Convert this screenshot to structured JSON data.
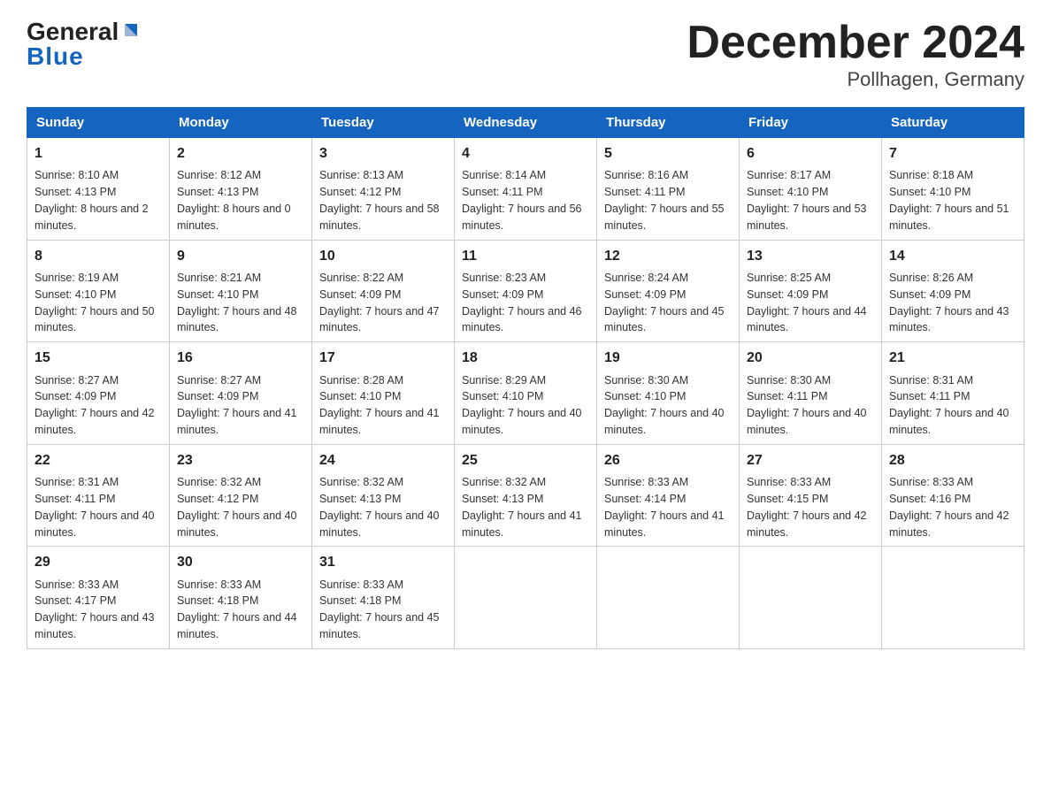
{
  "header": {
    "title": "December 2024",
    "subtitle": "Pollhagen, Germany"
  },
  "logo": {
    "general": "General",
    "blue": "Blue"
  },
  "days_of_week": [
    "Sunday",
    "Monday",
    "Tuesday",
    "Wednesday",
    "Thursday",
    "Friday",
    "Saturday"
  ],
  "weeks": [
    [
      {
        "day": "1",
        "sunrise": "Sunrise: 8:10 AM",
        "sunset": "Sunset: 4:13 PM",
        "daylight": "Daylight: 8 hours and 2 minutes."
      },
      {
        "day": "2",
        "sunrise": "Sunrise: 8:12 AM",
        "sunset": "Sunset: 4:13 PM",
        "daylight": "Daylight: 8 hours and 0 minutes."
      },
      {
        "day": "3",
        "sunrise": "Sunrise: 8:13 AM",
        "sunset": "Sunset: 4:12 PM",
        "daylight": "Daylight: 7 hours and 58 minutes."
      },
      {
        "day": "4",
        "sunrise": "Sunrise: 8:14 AM",
        "sunset": "Sunset: 4:11 PM",
        "daylight": "Daylight: 7 hours and 56 minutes."
      },
      {
        "day": "5",
        "sunrise": "Sunrise: 8:16 AM",
        "sunset": "Sunset: 4:11 PM",
        "daylight": "Daylight: 7 hours and 55 minutes."
      },
      {
        "day": "6",
        "sunrise": "Sunrise: 8:17 AM",
        "sunset": "Sunset: 4:10 PM",
        "daylight": "Daylight: 7 hours and 53 minutes."
      },
      {
        "day": "7",
        "sunrise": "Sunrise: 8:18 AM",
        "sunset": "Sunset: 4:10 PM",
        "daylight": "Daylight: 7 hours and 51 minutes."
      }
    ],
    [
      {
        "day": "8",
        "sunrise": "Sunrise: 8:19 AM",
        "sunset": "Sunset: 4:10 PM",
        "daylight": "Daylight: 7 hours and 50 minutes."
      },
      {
        "day": "9",
        "sunrise": "Sunrise: 8:21 AM",
        "sunset": "Sunset: 4:10 PM",
        "daylight": "Daylight: 7 hours and 48 minutes."
      },
      {
        "day": "10",
        "sunrise": "Sunrise: 8:22 AM",
        "sunset": "Sunset: 4:09 PM",
        "daylight": "Daylight: 7 hours and 47 minutes."
      },
      {
        "day": "11",
        "sunrise": "Sunrise: 8:23 AM",
        "sunset": "Sunset: 4:09 PM",
        "daylight": "Daylight: 7 hours and 46 minutes."
      },
      {
        "day": "12",
        "sunrise": "Sunrise: 8:24 AM",
        "sunset": "Sunset: 4:09 PM",
        "daylight": "Daylight: 7 hours and 45 minutes."
      },
      {
        "day": "13",
        "sunrise": "Sunrise: 8:25 AM",
        "sunset": "Sunset: 4:09 PM",
        "daylight": "Daylight: 7 hours and 44 minutes."
      },
      {
        "day": "14",
        "sunrise": "Sunrise: 8:26 AM",
        "sunset": "Sunset: 4:09 PM",
        "daylight": "Daylight: 7 hours and 43 minutes."
      }
    ],
    [
      {
        "day": "15",
        "sunrise": "Sunrise: 8:27 AM",
        "sunset": "Sunset: 4:09 PM",
        "daylight": "Daylight: 7 hours and 42 minutes."
      },
      {
        "day": "16",
        "sunrise": "Sunrise: 8:27 AM",
        "sunset": "Sunset: 4:09 PM",
        "daylight": "Daylight: 7 hours and 41 minutes."
      },
      {
        "day": "17",
        "sunrise": "Sunrise: 8:28 AM",
        "sunset": "Sunset: 4:10 PM",
        "daylight": "Daylight: 7 hours and 41 minutes."
      },
      {
        "day": "18",
        "sunrise": "Sunrise: 8:29 AM",
        "sunset": "Sunset: 4:10 PM",
        "daylight": "Daylight: 7 hours and 40 minutes."
      },
      {
        "day": "19",
        "sunrise": "Sunrise: 8:30 AM",
        "sunset": "Sunset: 4:10 PM",
        "daylight": "Daylight: 7 hours and 40 minutes."
      },
      {
        "day": "20",
        "sunrise": "Sunrise: 8:30 AM",
        "sunset": "Sunset: 4:11 PM",
        "daylight": "Daylight: 7 hours and 40 minutes."
      },
      {
        "day": "21",
        "sunrise": "Sunrise: 8:31 AM",
        "sunset": "Sunset: 4:11 PM",
        "daylight": "Daylight: 7 hours and 40 minutes."
      }
    ],
    [
      {
        "day": "22",
        "sunrise": "Sunrise: 8:31 AM",
        "sunset": "Sunset: 4:11 PM",
        "daylight": "Daylight: 7 hours and 40 minutes."
      },
      {
        "day": "23",
        "sunrise": "Sunrise: 8:32 AM",
        "sunset": "Sunset: 4:12 PM",
        "daylight": "Daylight: 7 hours and 40 minutes."
      },
      {
        "day": "24",
        "sunrise": "Sunrise: 8:32 AM",
        "sunset": "Sunset: 4:13 PM",
        "daylight": "Daylight: 7 hours and 40 minutes."
      },
      {
        "day": "25",
        "sunrise": "Sunrise: 8:32 AM",
        "sunset": "Sunset: 4:13 PM",
        "daylight": "Daylight: 7 hours and 41 minutes."
      },
      {
        "day": "26",
        "sunrise": "Sunrise: 8:33 AM",
        "sunset": "Sunset: 4:14 PM",
        "daylight": "Daylight: 7 hours and 41 minutes."
      },
      {
        "day": "27",
        "sunrise": "Sunrise: 8:33 AM",
        "sunset": "Sunset: 4:15 PM",
        "daylight": "Daylight: 7 hours and 42 minutes."
      },
      {
        "day": "28",
        "sunrise": "Sunrise: 8:33 AM",
        "sunset": "Sunset: 4:16 PM",
        "daylight": "Daylight: 7 hours and 42 minutes."
      }
    ],
    [
      {
        "day": "29",
        "sunrise": "Sunrise: 8:33 AM",
        "sunset": "Sunset: 4:17 PM",
        "daylight": "Daylight: 7 hours and 43 minutes."
      },
      {
        "day": "30",
        "sunrise": "Sunrise: 8:33 AM",
        "sunset": "Sunset: 4:18 PM",
        "daylight": "Daylight: 7 hours and 44 minutes."
      },
      {
        "day": "31",
        "sunrise": "Sunrise: 8:33 AM",
        "sunset": "Sunset: 4:18 PM",
        "daylight": "Daylight: 7 hours and 45 minutes."
      },
      null,
      null,
      null,
      null
    ]
  ]
}
